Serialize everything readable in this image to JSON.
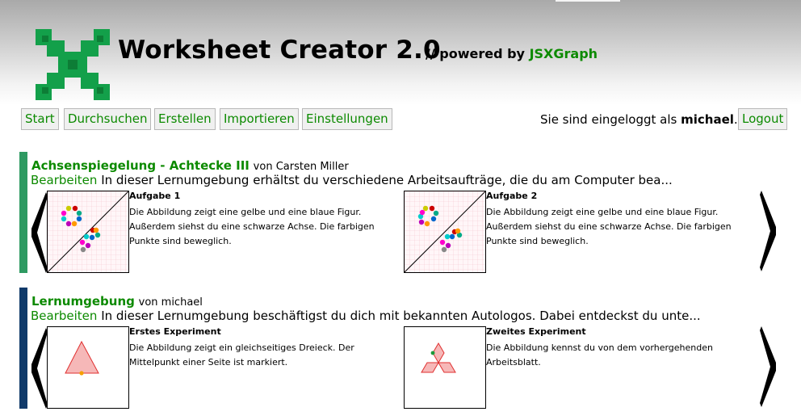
{
  "header": {
    "app_title": "Worksheet Creator 2.0",
    "powered_prefix": "// powered by",
    "powered_link": "JSXGraph",
    "logo_icon": "jsxgraph-logo-icon"
  },
  "nav": {
    "items": [
      "Start",
      "Durchsuchen",
      "Erstellen",
      "Importieren",
      "Einstellungen"
    ],
    "login_prefix": "Sie sind eingeloggt als",
    "user": "michael",
    "login_suffix": ".",
    "logout": "Logout"
  },
  "sections": [
    {
      "title": "Achsenspiegelung - Achtecke III",
      "author": "von Carsten Miller",
      "edit": "Bearbeiten",
      "description": "In dieser Lernumgebung erhältst du verschiedene Arbeitsaufträge, die du am Computer bea...",
      "tasks": [
        {
          "title": "Aufgabe 1",
          "text": "Die Abbildung zeigt eine gelbe und eine blaue Figur. Außerdem siehst du eine schwarze Achse. Die farbigen Punkte sind beweglich."
        },
        {
          "title": "Aufgabe 2",
          "text": "Die Abbildung zeigt eine gelbe und eine blaue Figur. Außerdem siehst du eine schwarze Achse. Die farbigen Punkte sind beweglich."
        }
      ]
    },
    {
      "title": "Lernumgebung",
      "author": "von michael",
      "edit": "Bearbeiten",
      "description": "In dieser Lernumgebung beschäftigst du dich mit bekannten Autologos. Dabei entdeckst du unte...",
      "tasks": [
        {
          "title": "Erstes Experiment",
          "text": "Die Abbildung zeigt ein gleichseitiges Dreieck. Der Mittelpunkt einer Seite ist markiert."
        },
        {
          "title": "Zweites Experiment",
          "text": "Die Abbildung kennst du von dem vorhergehenden Arbeitsblatt."
        }
      ]
    }
  ],
  "colors": {
    "accent_green": "#0c8a00",
    "section1_bar": "#2e9a62",
    "section2_bar": "#103a6a"
  },
  "icons": {
    "prev": "chevron-left-icon",
    "next": "chevron-right-icon"
  }
}
